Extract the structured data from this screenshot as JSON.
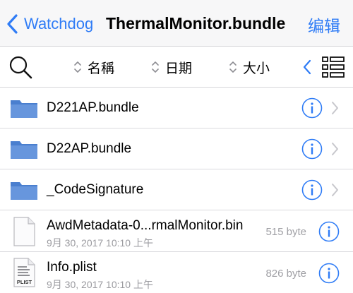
{
  "navbar": {
    "back_label": "Watchdog",
    "title": "ThermalMonitor.bundle",
    "edit_label": "编辑"
  },
  "toolbar": {
    "sort_name_label": "名稱",
    "sort_date_label": "日期",
    "sort_size_label": "大小"
  },
  "files": [
    {
      "name": "D221AP.bundle",
      "type": "folder"
    },
    {
      "name": "D22AP.bundle",
      "type": "folder"
    },
    {
      "name": "_CodeSignature",
      "type": "folder"
    },
    {
      "name": "AwdMetadata-0...rmalMonitor.bin",
      "date": "9月 30, 2017 10:10 上午",
      "size": "515 byte",
      "type": "file"
    },
    {
      "name": "Info.plist",
      "date": "9月 30, 2017 10:10 上午",
      "size": "826 byte",
      "type": "plist",
      "badge": "PLIST"
    }
  ],
  "colors": {
    "accent": "#2f7cf6",
    "folder": "#5a8fd8",
    "secondary_text": "#9a9a9f",
    "separator": "#dadade"
  },
  "icons": {
    "back": "chevron-left-icon",
    "search": "magnifier-icon",
    "sort": "up-down-arrows-icon",
    "collapse": "chevron-left-icon",
    "list_view": "list-view-icon",
    "folder": "folder-icon",
    "document": "document-icon",
    "info": "info-circle-icon",
    "disclosure": "chevron-right-icon"
  }
}
